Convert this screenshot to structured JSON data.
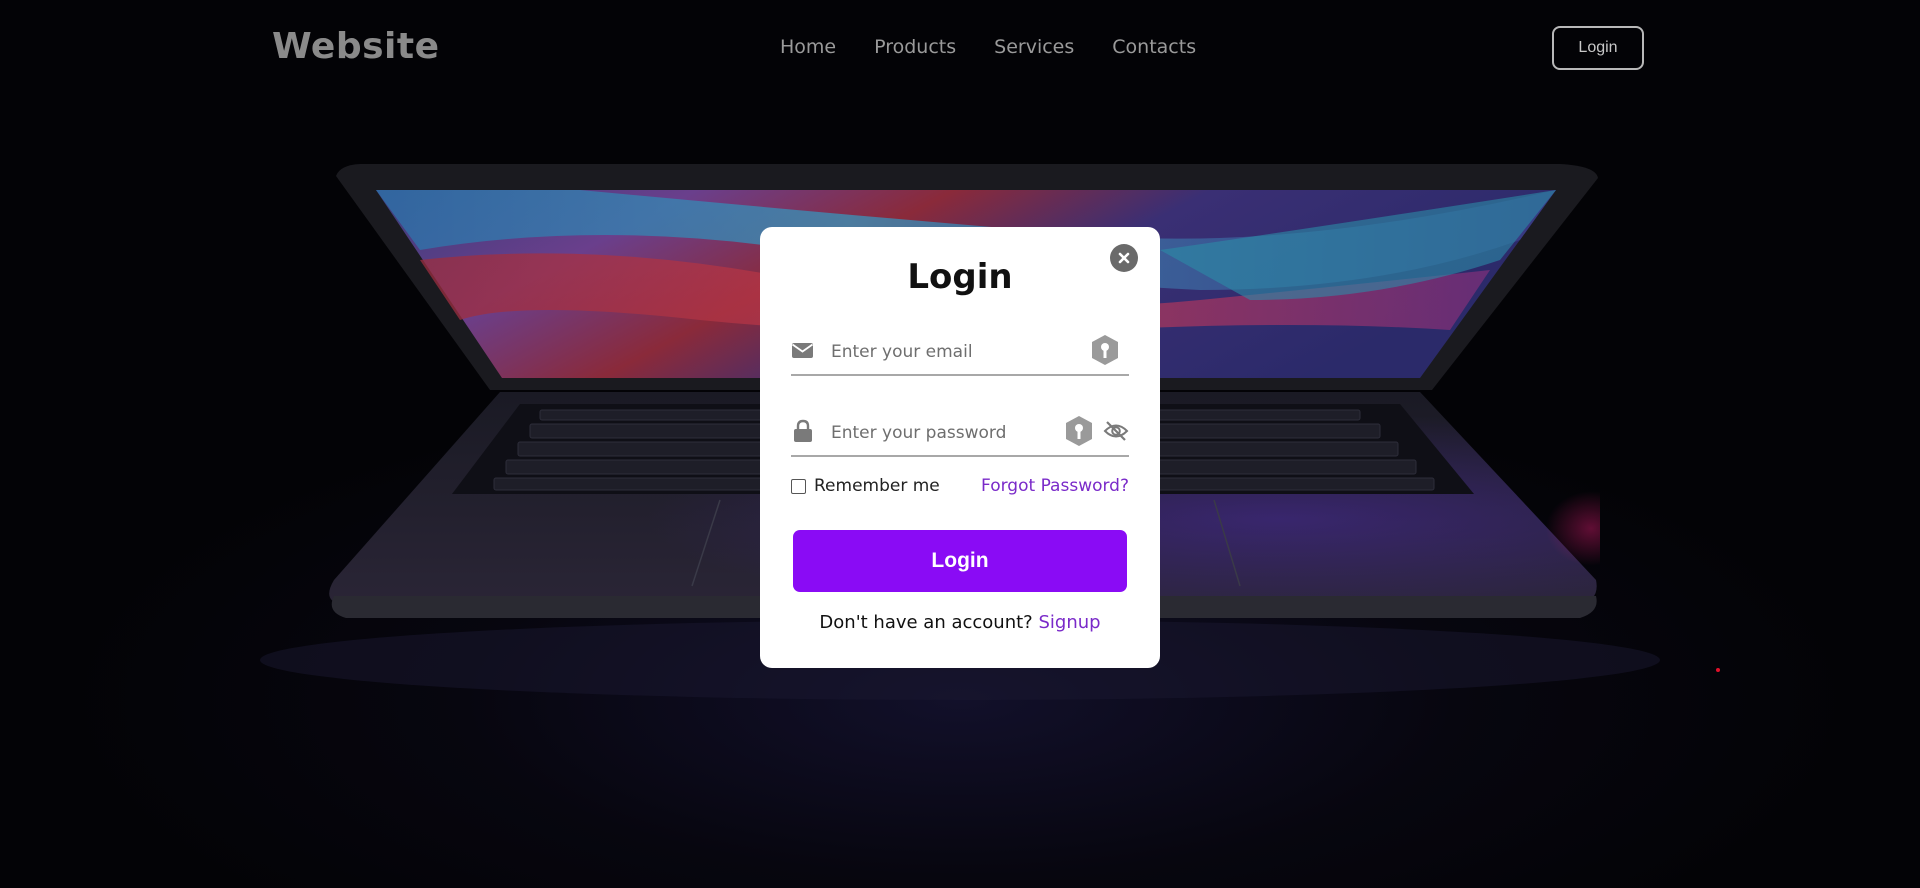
{
  "header": {
    "logo": "Website",
    "nav": [
      "Home",
      "Products",
      "Services",
      "Contacts"
    ],
    "login_button": "Login"
  },
  "modal": {
    "title": "Login",
    "email": {
      "placeholder": "Enter your email",
      "value": ""
    },
    "password": {
      "placeholder": "Enter your password",
      "value": ""
    },
    "remember_label": "Remember me",
    "remember_checked": false,
    "forgot_label": "Forgot Password?",
    "submit_label": "Login",
    "signup_prompt": "Don't have an account?",
    "signup_link": "Signup"
  },
  "icons": {
    "close": "close-icon",
    "email": "envelope-icon",
    "password": "lock-icon",
    "key_badge": "key-icon",
    "visibility": "eye-slash-icon"
  },
  "colors": {
    "accent": "#8a0bf5",
    "link": "#7a2ac9",
    "background": "#05040a",
    "modal": "#ffffff"
  }
}
